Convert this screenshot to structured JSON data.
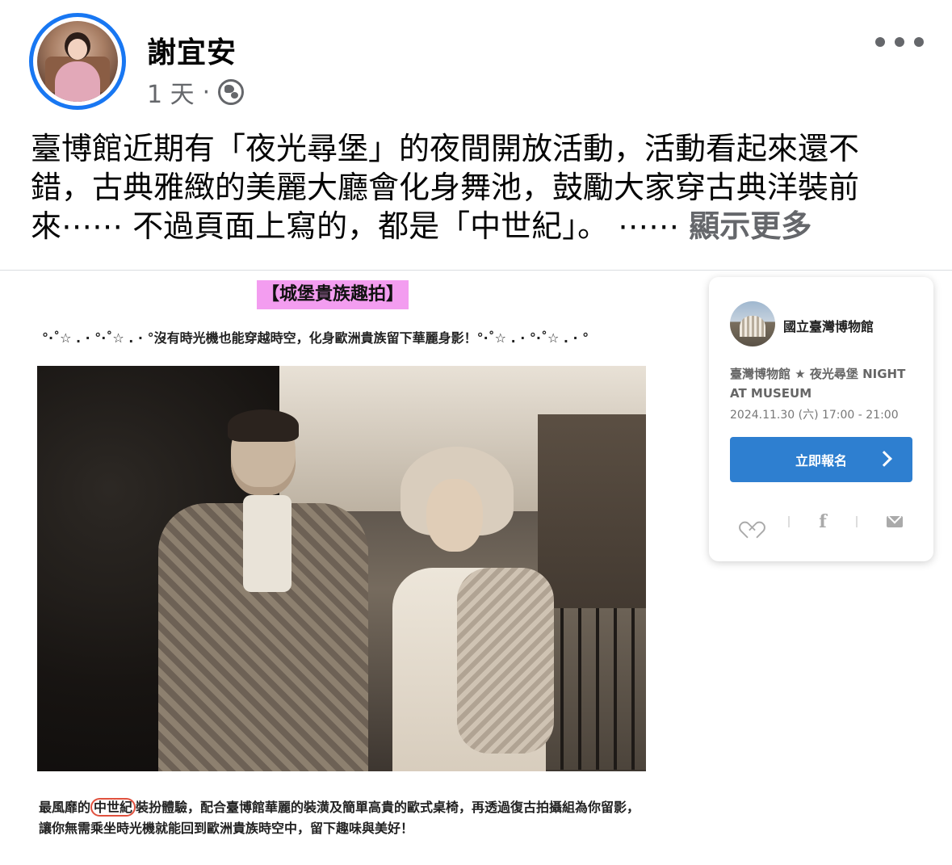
{
  "post": {
    "author_name": "謝宜安",
    "timestamp": "1 天",
    "meta_separator": "·",
    "privacy_icon": "globe-icon",
    "more_icon": "more-horizontal-icon",
    "text": "臺博館近期有「夜光尋堡」的夜間開放活動，活動看起來還不錯，古典雅緻的美麗大廳會化身舞池，鼓勵大家穿古典洋裝前來⋯⋯ 不過頁面上寫的，都是「中世紀」。 ⋯⋯ ",
    "see_more": "顯示更多"
  },
  "image": {
    "heading": "【城堡貴族趣拍】",
    "subline": "°·˚☆ . · °·˚☆ . · °沒有時光機也能穿越時空，化身歐洲貴族留下華麗身影！°·˚☆ . · °·˚☆ . · °",
    "caption_before": "最風靡的",
    "caption_highlight": "中世紀",
    "caption_after": "裝扮體驗，配合臺博館華麗的裝潢及簡單高貴的歐式桌椅，再透過復古拍攝組為你留影，讓你無需乘坐時光機就能回到歐洲貴族時空中，留下趣味與美好！"
  },
  "event_card": {
    "org_name": "國立臺灣博物館",
    "event_title": "臺灣博物館 ★ 夜光尋堡 NIGHT AT MUSEUM",
    "event_date": "2024.11.30 (六) 17:00 - 21:00",
    "register_label": "立即報名",
    "facebook_glyph": "f",
    "accent_color": "#2e7fd0"
  }
}
